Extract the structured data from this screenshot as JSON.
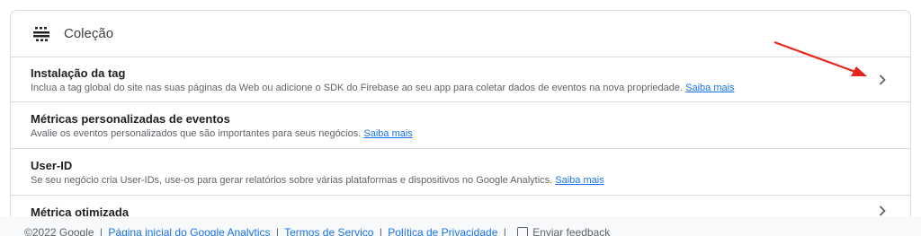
{
  "header": {
    "title": "Coleção",
    "icon": "collection-icon"
  },
  "rows": [
    {
      "title": "Instalação da tag",
      "description": "Inclua a tag global do site nas suas páginas da Web ou adicione o SDK do Firebase ao seu app para coletar dados de eventos na nova propriedade.",
      "link": "Saiba mais",
      "has_chevron": true
    },
    {
      "title": "Métricas personalizadas de eventos",
      "description": "Avalie os eventos personalizados que são importantes para seus negócios.",
      "link": "Saiba mais",
      "has_chevron": false
    },
    {
      "title": "User-ID",
      "description": "Se seu negócio cria User-IDs, use-os para gerar relatórios sobre várias plataformas e dispositivos no Google Analytics.",
      "link": "Saiba mais",
      "has_chevron": false
    },
    {
      "title": "Métrica otimizada",
      "description": "",
      "link": "",
      "has_chevron": true
    }
  ],
  "footer": {
    "copyright": "©2022 Google",
    "separator": "|",
    "links": [
      "Página inicial do Google Analytics",
      "Termos de Serviço",
      "Política de Privacidade"
    ],
    "feedback": "Enviar feedback"
  },
  "colors": {
    "link": "#1a73e8",
    "border": "#dadce0",
    "annotation_arrow": "#e8251c"
  },
  "icons": [
    "collection-icon",
    "chevron-right-icon",
    "feedback-icon",
    "annotation-arrow"
  ]
}
